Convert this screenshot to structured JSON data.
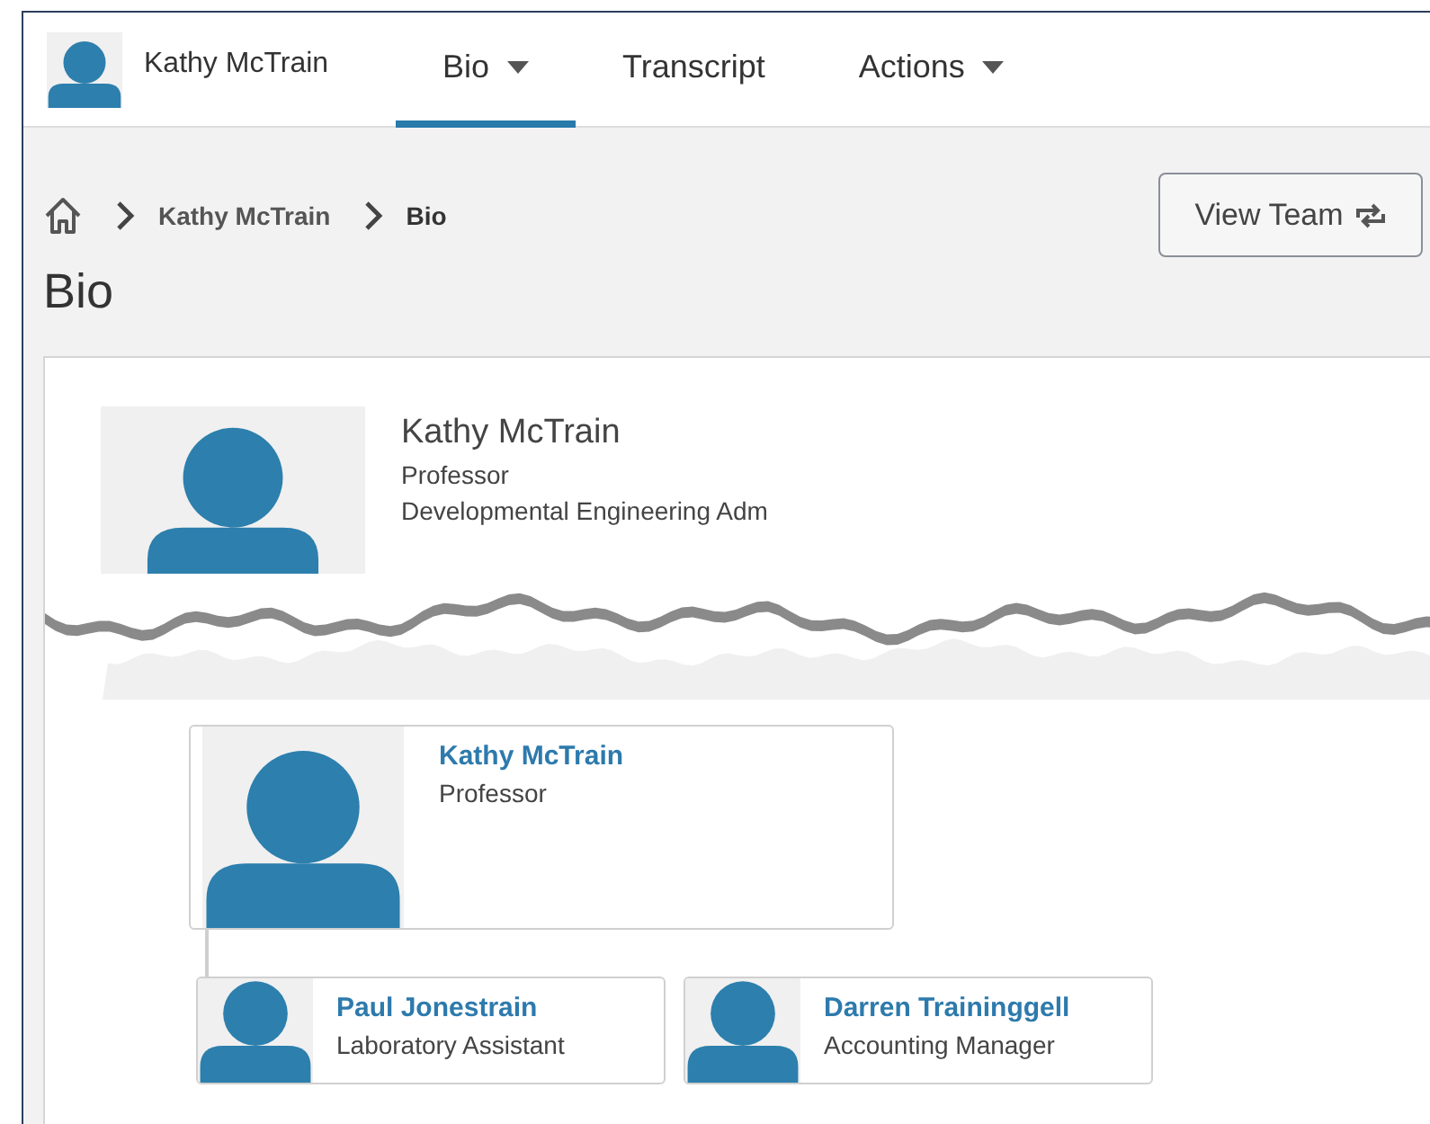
{
  "header": {
    "user_name": "Kathy McTrain"
  },
  "tabs": [
    {
      "label": "Bio",
      "selected": true,
      "dropdown": true
    },
    {
      "label": "Transcript",
      "selected": false,
      "dropdown": false
    },
    {
      "label": "Actions",
      "selected": false,
      "dropdown": true
    }
  ],
  "breadcrumb": [
    "Kathy McTrain",
    "Bio"
  ],
  "page_title": "Bio",
  "view_team_button": "View Team",
  "profile": {
    "name": "Kathy McTrain",
    "title": "Professor",
    "department": "Developmental Engineering Adm"
  },
  "org_chart": {
    "name": "Kathy McTrain",
    "title": "Professor",
    "reports": [
      {
        "name": "Paul Jonestrain",
        "title": "Laboratory Assistant"
      },
      {
        "name": "Darren Traininggell",
        "title": "Accounting Manager"
      }
    ]
  }
}
